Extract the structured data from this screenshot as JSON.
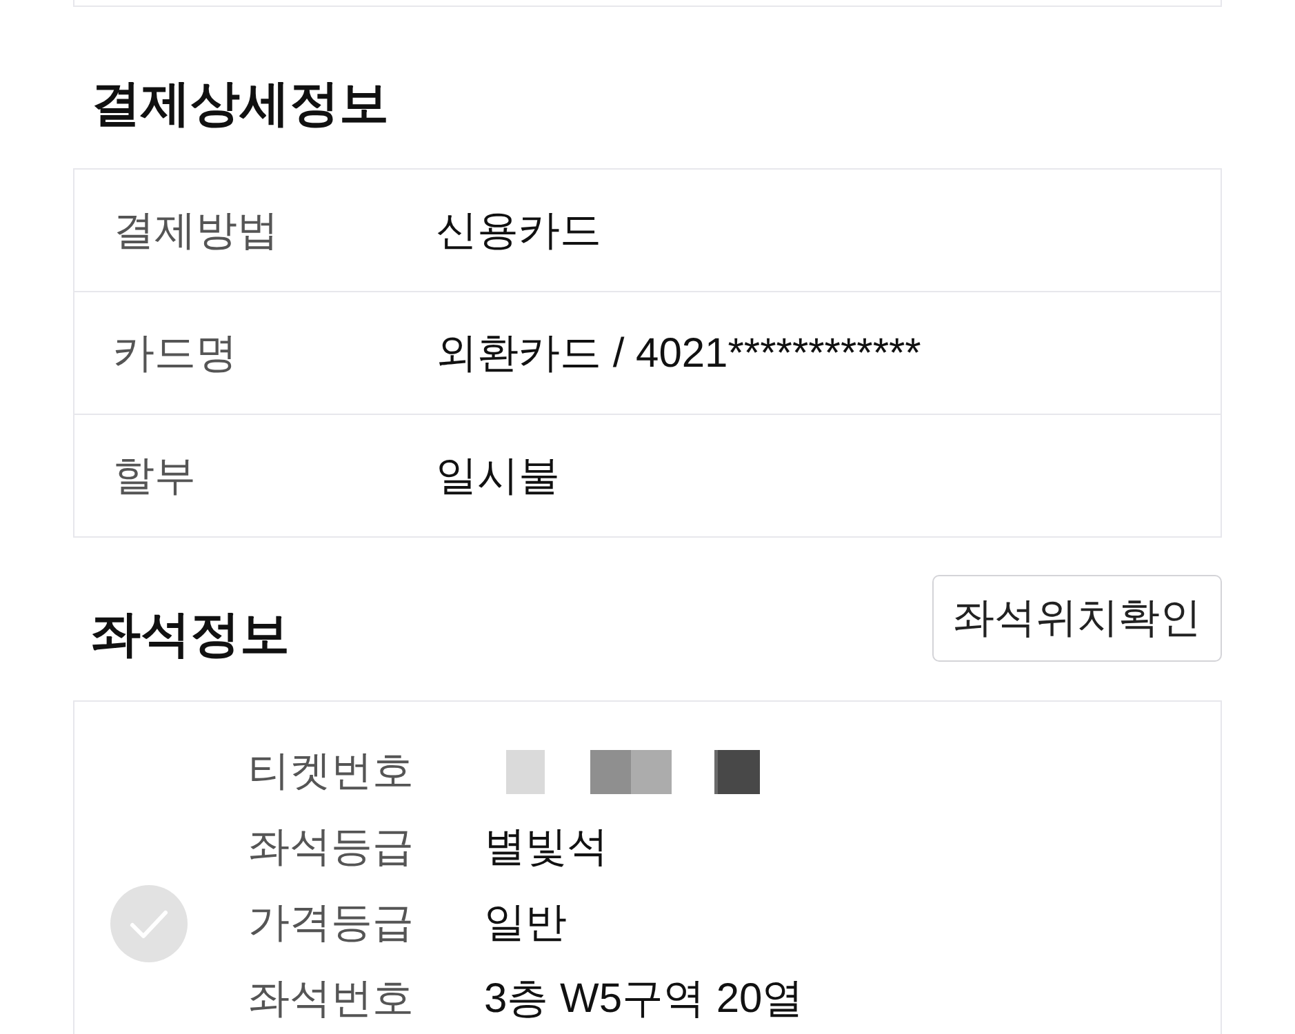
{
  "payment_details": {
    "title": "결제상세정보",
    "rows": [
      {
        "label": "결제방법",
        "value": "신용카드"
      },
      {
        "label": "카드명",
        "value": "외환카드 / 4021************"
      },
      {
        "label": "할부",
        "value": "일시불"
      }
    ]
  },
  "seat_info": {
    "title": "좌석정보",
    "location_button": "좌석위치확인",
    "ticket": {
      "checked": false,
      "fields": [
        {
          "kind": "redacted",
          "label": "티켓번호"
        },
        {
          "kind": "text",
          "label": "좌석등급",
          "value": "별빛석"
        },
        {
          "kind": "text",
          "label": "가격등급",
          "value": "일반"
        },
        {
          "kind": "text",
          "label": "좌석번호",
          "value": "3층 W5구역 20열"
        }
      ]
    }
  }
}
